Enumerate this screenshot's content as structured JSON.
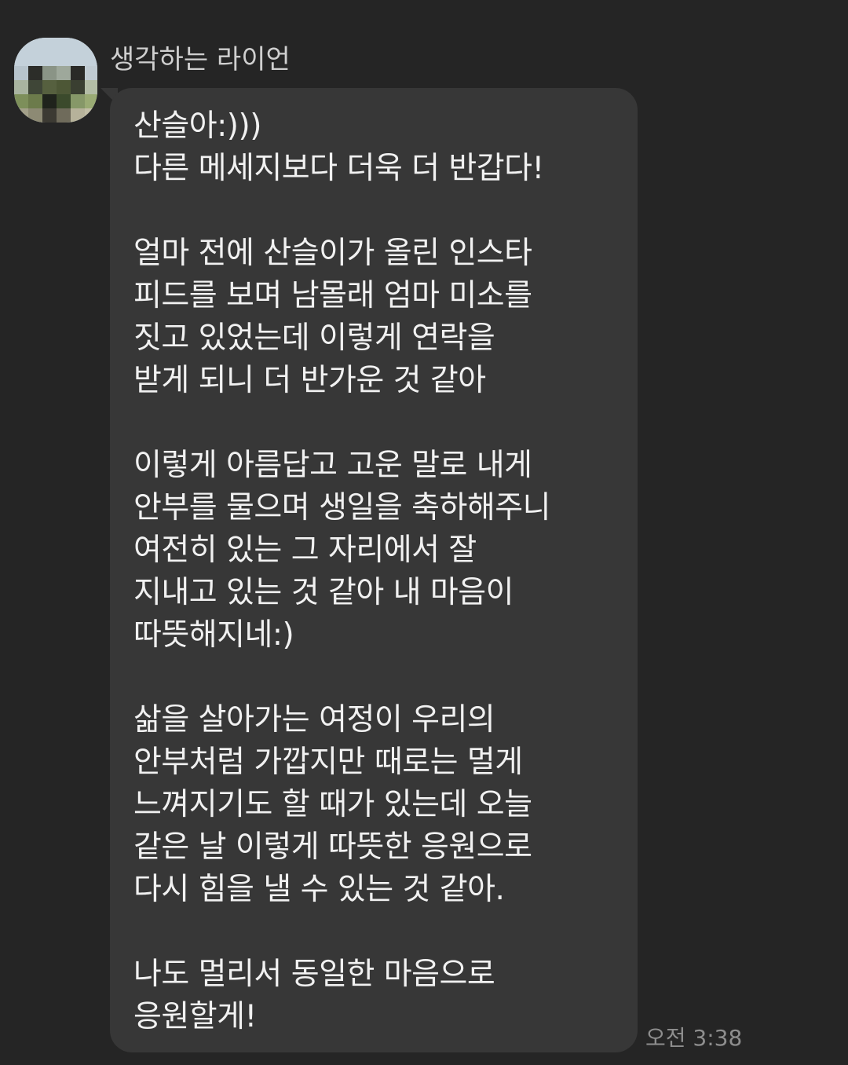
{
  "chat": {
    "sender_name": "생각하는 라이언",
    "sender_avatar_icon": "profile-avatar-pixelated",
    "message": {
      "lines": [
        "산슬아:)))",
        "다른 메세지보다 더욱 더 반갑다!",
        "",
        "얼마 전에 산슬이가 올린 인스타",
        "피드를 보며 남몰래 엄마 미소를",
        "짓고 있었는데 이렇게 연락을",
        "받게 되니 더 반가운 것 같아",
        "",
        "이렇게 아름답고 고운 말로 내게",
        "안부를 물으며 생일을 축하해주니",
        "여전히 있는 그 자리에서 잘",
        "지내고 있는 것 같아 내 마음이",
        "따뜻해지네:)",
        "",
        "삶을 살아가는 여정이 우리의",
        "안부처럼 가깝지만 때로는 멀게",
        "느껴지기도 할 때가 있는데 오늘",
        "같은 날 이렇게 따뜻한 응원으로",
        "다시 힘을 낼 수 있는 것 같아.",
        "",
        "나도 멀리서 동일한 마음으로",
        "응원할게!"
      ],
      "timestamp": "오전 3:38"
    },
    "colors": {
      "background": "#252525",
      "bubble": "#373737",
      "text": "#f1f1f1",
      "meta_text": "#8e8e8e"
    }
  }
}
